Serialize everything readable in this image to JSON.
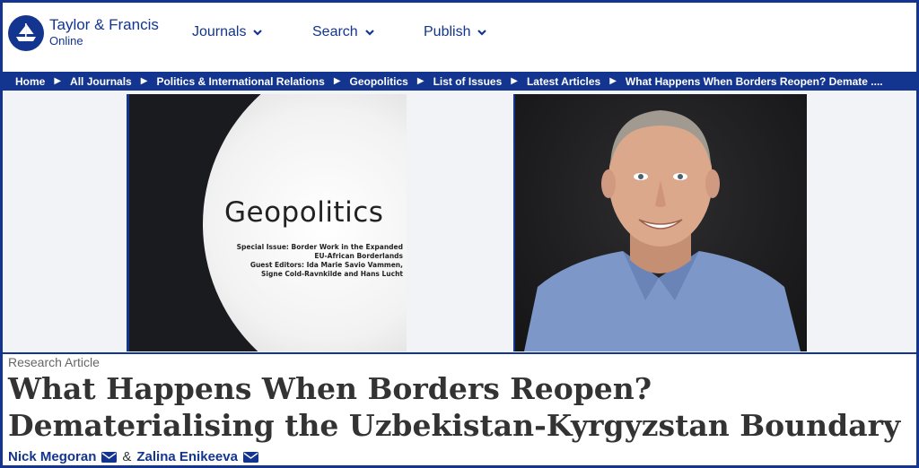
{
  "header": {
    "logo_name": "Taylor & Francis",
    "logo_sub": "Online",
    "nav": [
      {
        "label": "Journals"
      },
      {
        "label": "Search"
      },
      {
        "label": "Publish"
      }
    ]
  },
  "breadcrumb": {
    "items": [
      "Home",
      "All Journals",
      "Politics & International Relations",
      "Geopolitics",
      "List of Issues",
      "Latest Articles"
    ],
    "current": "What Happens When Borders Reopen? Demate ...."
  },
  "cover": {
    "title": "Geopolitics",
    "line1": "Special Issue: Border Work in the Expanded",
    "line2": "EU-African Borderlands",
    "line3": "Guest Editors: Ida Marie Savio Vammen,",
    "line4": "Signe Cold-Ravnkilde and  Hans Lucht"
  },
  "article": {
    "type": "Research Article",
    "title": "What Happens When Borders Reopen? Dematerialising the Uzbekistan-Kyrgyzstan Boundary",
    "authors": [
      "Nick Megoran",
      "Zalina Enikeeva"
    ],
    "separator": "&"
  },
  "colors": {
    "brand": "#13358f",
    "title_text": "#333333"
  },
  "icons": [
    "logo-emblem-icon",
    "chevron-down-icon",
    "triangle-right-icon",
    "envelope-icon"
  ]
}
